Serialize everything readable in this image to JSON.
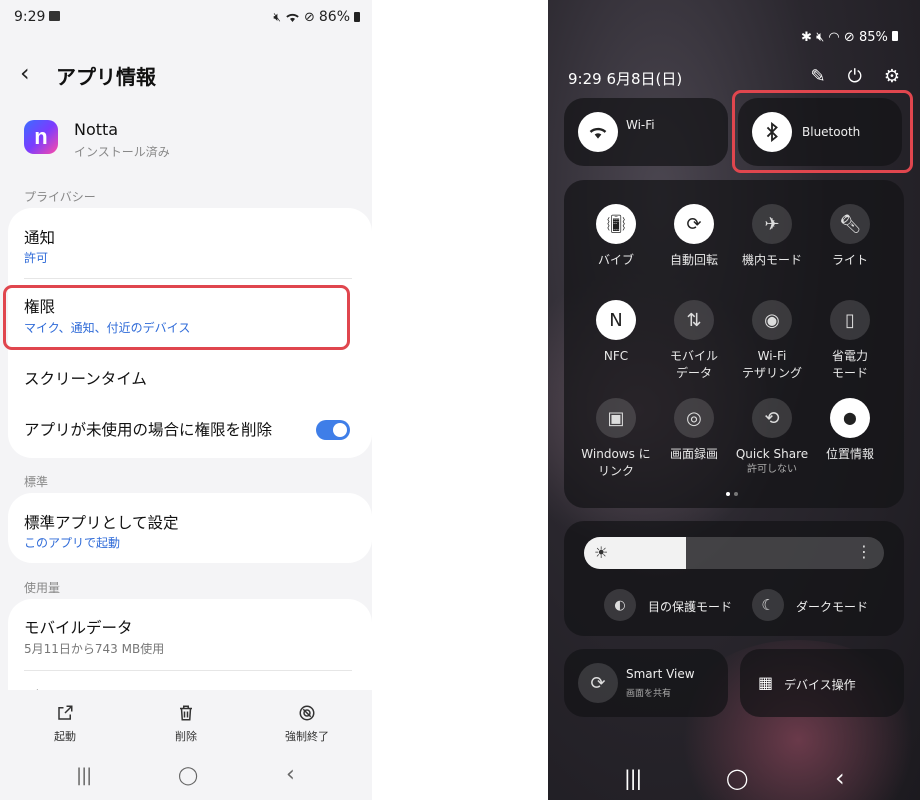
{
  "left": {
    "status": {
      "time": "9:29",
      "battery": "86%"
    },
    "header": {
      "back": "‹",
      "title": "アプリ情報"
    },
    "app": {
      "icon_letter": "n",
      "name": "Notta",
      "status": "インストール済み"
    },
    "sections": {
      "privacy": "プライバシー",
      "standard": "標準",
      "usage": "使用量"
    },
    "privacy_rows": {
      "notifications": {
        "title": "通知",
        "sub": "許可"
      },
      "permissions": {
        "title": "権限",
        "sub": "マイク、通知、付近のデバイス"
      },
      "screen_time": {
        "title": "スクリーンタイム"
      },
      "remove_permissions": {
        "title": "アプリが未使用の場合に権限を削除",
        "enabled": true
      }
    },
    "standard_rows": {
      "default_app": {
        "title": "標準アプリとして設定",
        "sub": "このアプリで起動"
      }
    },
    "usage_rows": {
      "mobile_data": {
        "title": "モバイルデータ",
        "sub": "5月11日から743 MB使用"
      },
      "battery": {
        "title": "バッテリー"
      }
    },
    "bottom_bar": {
      "open": "起動",
      "uninstall": "削除",
      "force_stop": "強制終了"
    },
    "nav": {
      "recents": "|||",
      "home": "◯",
      "back": "‹"
    }
  },
  "right": {
    "status": {
      "battery": "85%"
    },
    "top": {
      "datetime": "9:29  6月8日(日)"
    },
    "wide_tiles": {
      "wifi": {
        "label": "Wi-Fi",
        "active": true
      },
      "bluetooth": {
        "label": "Bluetooth",
        "active": true
      }
    },
    "tiles": [
      {
        "icon": "vibrate-icon",
        "label": "バイブ",
        "active": true
      },
      {
        "icon": "auto-rotate-icon",
        "label": "自動回転",
        "active": true
      },
      {
        "icon": "airplane-icon",
        "label": "機内モード",
        "active": false
      },
      {
        "icon": "flashlight-icon",
        "label": "ライト",
        "active": false
      },
      {
        "icon": "nfc-icon",
        "label": "NFC",
        "active": true
      },
      {
        "icon": "mobile-data-icon",
        "label": "モバイル\nデータ",
        "active": false
      },
      {
        "icon": "hotspot-icon",
        "label": "Wi-Fi\nテザリング",
        "active": false
      },
      {
        "icon": "power-saving-icon",
        "label": "省電力\nモード",
        "active": false
      },
      {
        "icon": "link-to-windows-icon",
        "label": "Windows に\nリンク",
        "active": false
      },
      {
        "icon": "screen-record-icon",
        "label": "画面録画",
        "active": false
      },
      {
        "icon": "quick-share-icon",
        "label": "Quick Share",
        "sub": "許可しない",
        "active": false
      },
      {
        "icon": "location-icon",
        "label": "位置情報",
        "active": true
      }
    ],
    "brightness": {
      "level": 0.34
    },
    "display_options": {
      "eye_comfort": "目の保護モード",
      "dark_mode": "ダークモード"
    },
    "bottom_tiles": {
      "smart_view": {
        "label": "Smart View",
        "sub": "画面を共有"
      },
      "device_control": {
        "label": "デバイス操作"
      }
    },
    "nav": {
      "recents": "|||",
      "home": "◯",
      "back": "‹"
    }
  },
  "colors": {
    "highlight": "#e0464e",
    "link_blue": "#2f6bd8",
    "toggle_blue": "#3f7ee8"
  }
}
